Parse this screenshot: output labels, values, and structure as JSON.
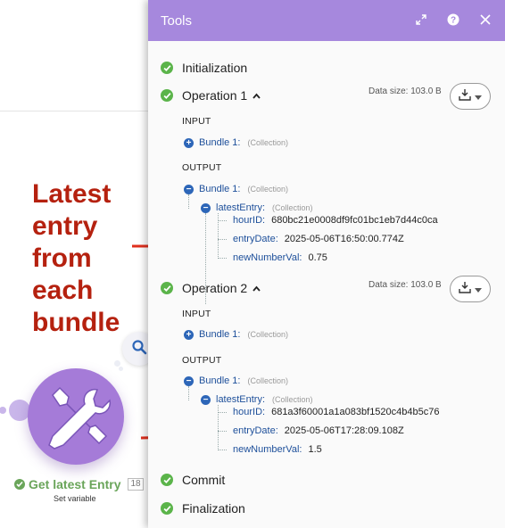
{
  "annotation": {
    "text": "Latest entry from each bundle"
  },
  "module": {
    "title": "Get latest Entry",
    "badge": "18",
    "subtitle": "Set variable"
  },
  "panel": {
    "title": "Tools",
    "header_icons": [
      "expand-icon",
      "help-icon",
      "close-icon"
    ],
    "stages": {
      "initialization": "Initialization",
      "commit": "Commit",
      "finalization": "Finalization"
    },
    "operations": [
      {
        "label": "Operation 1",
        "caret": "^",
        "data_size": "Data size: 103.0 B",
        "input_label": "INPUT",
        "input_bundle": "Bundle 1:",
        "input_collection": "(Collection)",
        "output_label": "OUTPUT",
        "output_bundle": "Bundle 1:",
        "output_collection": "(Collection)",
        "latest_key": "latestEntry:",
        "latest_collection": "(Collection)",
        "fields": [
          {
            "key": "hourID:",
            "value": "680bc21e0008df9fc01bc1eb7d44c0ca"
          },
          {
            "key": "entryDate:",
            "value": "2025-05-06T16:50:00.774Z"
          },
          {
            "key": "newNumberVal:",
            "value": "0.75"
          }
        ]
      },
      {
        "label": "Operation 2",
        "caret": "^",
        "data_size": "Data size: 103.0 B",
        "input_label": "INPUT",
        "input_bundle": "Bundle 1:",
        "input_collection": "(Collection)",
        "output_label": "OUTPUT",
        "output_bundle": "Bundle 1:",
        "output_collection": "(Collection)",
        "latest_key": "latestEntry:",
        "latest_collection": "(Collection)",
        "fields": [
          {
            "key": "hourID:",
            "value": "681a3f60001a1a083bf1520c4b4b5c76"
          },
          {
            "key": "entryDate:",
            "value": "2025-05-06T17:28:09.108Z"
          },
          {
            "key": "newNumberVal:",
            "value": "1.5"
          }
        ]
      }
    ]
  },
  "colors": {
    "panel_header": "#a688dd",
    "check": "#5bb44a",
    "tree_key": "#1d4f9a",
    "annotation": "#b5210f",
    "arrow": "#e0301e",
    "module": "#a57bd8"
  }
}
